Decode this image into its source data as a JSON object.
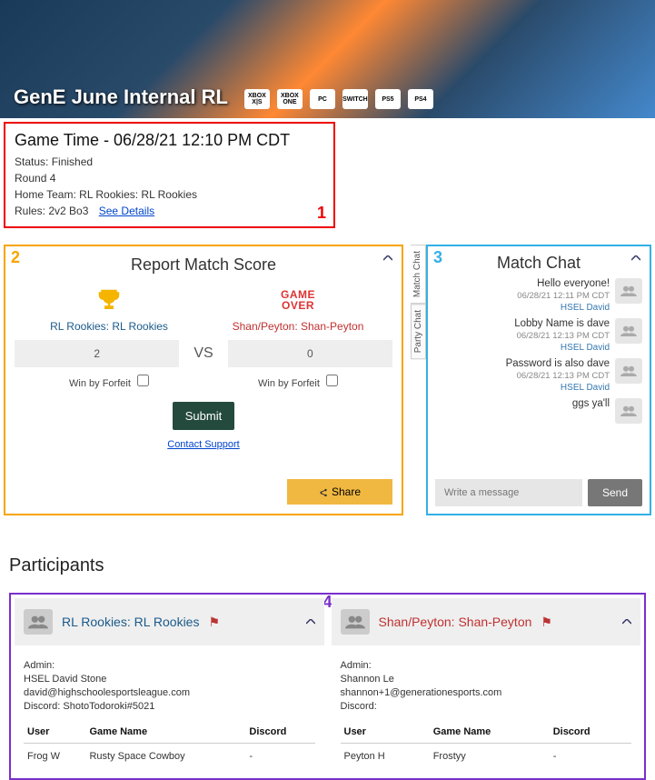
{
  "banner": {
    "title": "GenE June Internal RL",
    "platforms": [
      "XBOX X|S",
      "XBOX ONE",
      "PC",
      "SWITCH",
      "PS5",
      "PS4"
    ]
  },
  "game_time": {
    "heading": "Game Time - 06/28/21 12:10 PM CDT",
    "status_label": "Status:",
    "status_value": "Finished",
    "round": "Round 4",
    "home_team_label": "Home Team:",
    "home_team_value": "RL Rookies: RL Rookies",
    "rules_label": "Rules:",
    "rules_value": "2v2 Bo3",
    "see_details": "See Details",
    "marker": "1"
  },
  "report": {
    "marker": "2",
    "title": "Report Match Score",
    "team1": {
      "name": "RL Rookies: RL Rookies",
      "score": "2"
    },
    "team2": {
      "name": "Shan/Peyton: Shan-Peyton",
      "score": "0",
      "game_over": "GAME OVER"
    },
    "vs": "VS",
    "forfeit_label": "Win by Forfeit",
    "submit": "Submit",
    "contact": "Contact Support",
    "share": "Share"
  },
  "chat": {
    "marker": "3",
    "tabs": {
      "match": "Match Chat",
      "party": "Party Chat"
    },
    "title": "Match Chat",
    "messages": [
      {
        "text": "Hello everyone!",
        "time": "06/28/21 12:11 PM CDT",
        "author": "HSEL David"
      },
      {
        "text": "Lobby Name is dave",
        "time": "06/28/21 12:13 PM CDT",
        "author": "HSEL David"
      },
      {
        "text": "Password is also dave",
        "time": "06/28/21 12:13 PM CDT",
        "author": "HSEL David"
      },
      {
        "text": "ggs ya'll",
        "time": "",
        "author": ""
      }
    ],
    "input_placeholder": "Write a message",
    "send": "Send"
  },
  "participants": {
    "heading": "Participants",
    "marker": "4",
    "team1": {
      "name": "RL Rookies: RL Rookies",
      "admin_label": "Admin:",
      "admin_name": "HSEL David Stone",
      "admin_email": "david@highschoolesportsleague.com",
      "discord_label": "Discord:",
      "discord_value": "ShotoTodoroki#5021",
      "cols": {
        "user": "User",
        "game": "Game Name",
        "discord": "Discord"
      },
      "rows": [
        {
          "user": "Frog W",
          "game": "Rusty Space Cowboy",
          "discord": "-"
        }
      ]
    },
    "team2": {
      "name": "Shan/Peyton: Shan-Peyton",
      "admin_label": "Admin:",
      "admin_name": "Shannon Le",
      "admin_email": "shannon+1@generationesports.com",
      "discord_label": "Discord:",
      "discord_value": "",
      "cols": {
        "user": "User",
        "game": "Game Name",
        "discord": "Discord"
      },
      "rows": [
        {
          "user": "Peyton H",
          "game": "Frostyy",
          "discord": "-"
        }
      ]
    }
  }
}
